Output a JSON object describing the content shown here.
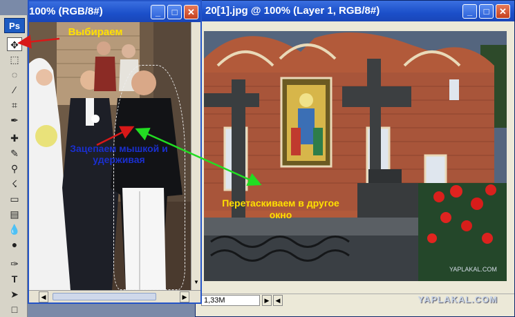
{
  "back_window": {
    "title": "20[1].jpg @ 100% (Layer 1, RGB/8#)",
    "status_zoom": "",
    "status_doc": "1,33M",
    "watermark": "YAPLAKAL.COM",
    "inner_watermark": "YAPLAKAL.COM"
  },
  "front_window": {
    "title": "100% (RGB/8#)",
    "partial_title_prefix": "-"
  },
  "toolbox": {
    "logo": "Ps",
    "tools": [
      "move-tool",
      "marquee-tool",
      "lasso-tool",
      "magic-wand-tool",
      "crop-tool",
      "eyedropper-tool",
      "healing-tool",
      "brush-tool",
      "clone-stamp-tool",
      "history-brush-tool",
      "eraser-tool",
      "gradient-tool",
      "blur-tool",
      "dodge-tool",
      "pen-tool",
      "type-tool",
      "path-selection-tool",
      "shape-tool"
    ]
  },
  "annotations": {
    "choose": "Выбираем",
    "grab": "Зацепаем мышкой и удерживая",
    "drag": "Перетаскиваем в другое окно"
  },
  "colors": {
    "titlebar": "#2454c7",
    "annot_yellow": "#ffe000",
    "annot_blue": "#1a2fcf",
    "arrow_red": "#d81818",
    "arrow_green": "#22dd22"
  }
}
